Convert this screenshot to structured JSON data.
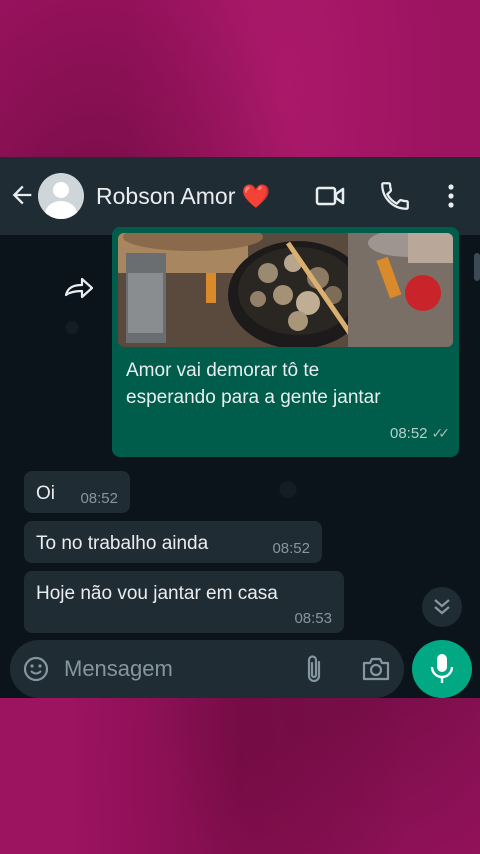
{
  "header": {
    "contact_name": "Robson Amor",
    "contact_emoji": "❤️",
    "icons": [
      "back-arrow-icon",
      "avatar",
      "video-call-icon",
      "phone-icon",
      "more-vert-icon"
    ]
  },
  "messages": [
    {
      "direction": "outgoing",
      "type": "image_with_caption",
      "forwarded": true,
      "caption": "Amor vai demorar tô te esperando para a gente jantar",
      "caption_line1": "Amor vai demorar tô te",
      "caption_line2": "esperando para a gente jantar",
      "time": "08:52",
      "status": "read"
    },
    {
      "direction": "incoming",
      "text": "Oi",
      "time": "08:52"
    },
    {
      "direction": "incoming",
      "text": "To no trabalho ainda",
      "time": "08:52"
    },
    {
      "direction": "incoming",
      "text": "Hoje não vou jantar em casa",
      "time": "08:53"
    }
  ],
  "composer": {
    "placeholder": "Mensagem",
    "icons": [
      "emoji-icon",
      "attach-icon",
      "camera-icon",
      "mic-icon"
    ]
  },
  "colors": {
    "background": "#9c1360",
    "header": "#1f2c34",
    "chat_bg": "#0b141a",
    "outgoing_bubble": "#005c4b",
    "incoming_bubble": "#202c33",
    "accent": "#00a884"
  }
}
